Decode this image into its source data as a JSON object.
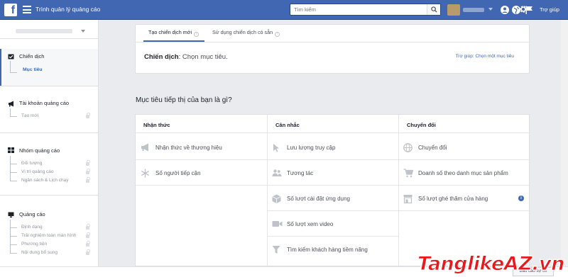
{
  "topbar": {
    "logo": "f",
    "app_title": "Trình quản lý quảng cáo",
    "search_placeholder": "Tìm kiếm",
    "help": "Trợ giúp"
  },
  "sidebar": {
    "sections": [
      {
        "title": "Chiến dịch",
        "icon": "checkbox-folder-icon",
        "items": [
          {
            "label": "Mục tiêu",
            "active": true,
            "locked": false
          }
        ]
      },
      {
        "title": "Tài khoản quảng cáo",
        "icon": "megaphone-icon",
        "items": [
          {
            "label": "Tạo mới",
            "locked": true
          }
        ]
      },
      {
        "title": "Nhóm quảng cáo",
        "icon": "grid-icon",
        "items": [
          {
            "label": "Đối tượng",
            "locked": true
          },
          {
            "label": "Vị trí quảng cáo",
            "locked": true
          },
          {
            "label": "Ngân sách & Lịch chạy",
            "locked": true
          }
        ]
      },
      {
        "title": "Quảng cáo",
        "icon": "monitor-icon",
        "items": [
          {
            "label": "Định dạng",
            "locked": true
          },
          {
            "label": "Trải nghiệm toàn màn hình",
            "locked": true
          },
          {
            "label": "Phương tiện",
            "locked": true
          },
          {
            "label": "Nội dung bổ sung",
            "locked": true
          }
        ]
      }
    ]
  },
  "top_card": {
    "tabs": [
      {
        "label": "Tạo chiến dịch mới",
        "active": true
      },
      {
        "label": "Sử dụng chiến dịch có sẵn",
        "active": false
      }
    ],
    "campaign_label": "Chiến dịch",
    "campaign_hint": ": Chọn mục tiêu.",
    "help_link": "Trợ giúp: Chọn một mục tiêu"
  },
  "objectives": {
    "question": "Mục tiêu tiếp thị của bạn là gì?",
    "columns": [
      {
        "title": "Nhận thức",
        "items": [
          {
            "label": "Nhận thức về thương hiệu",
            "icon": "megaphone-icon"
          },
          {
            "label": "Số người tiếp cận",
            "icon": "snowflake-icon"
          }
        ]
      },
      {
        "title": "Cân nhắc",
        "items": [
          {
            "label": "Lưu lượng truy cập",
            "icon": "cursor-icon"
          },
          {
            "label": "Tương tác",
            "icon": "people-icon"
          },
          {
            "label": "Số lượt cài đặt ứng dụng",
            "icon": "box-icon"
          },
          {
            "label": "Số lượt xem video",
            "icon": "video-camera-icon"
          },
          {
            "label": "Tìm kiếm khách hàng tiềm năng",
            "icon": "funnel-icon"
          }
        ]
      },
      {
        "title": "Chuyển đổi",
        "items": [
          {
            "label": "Chuyển đổi",
            "icon": "globe-icon"
          },
          {
            "label": "Doanh số theo danh mục sản phẩm",
            "icon": "shopping-cart-icon"
          },
          {
            "label": "Số lượt ghé thăm cửa hàng",
            "icon": "store-icon",
            "info": "i"
          }
        ]
      }
    ]
  },
  "footer": {
    "report_button": "Báo cáo sự cố"
  },
  "watermark": "TanglikeAZ.vn",
  "colors": {
    "brand": "#4267b2",
    "text": "#1d2129",
    "muted": "#90949c",
    "watermark": "#e8181f"
  }
}
